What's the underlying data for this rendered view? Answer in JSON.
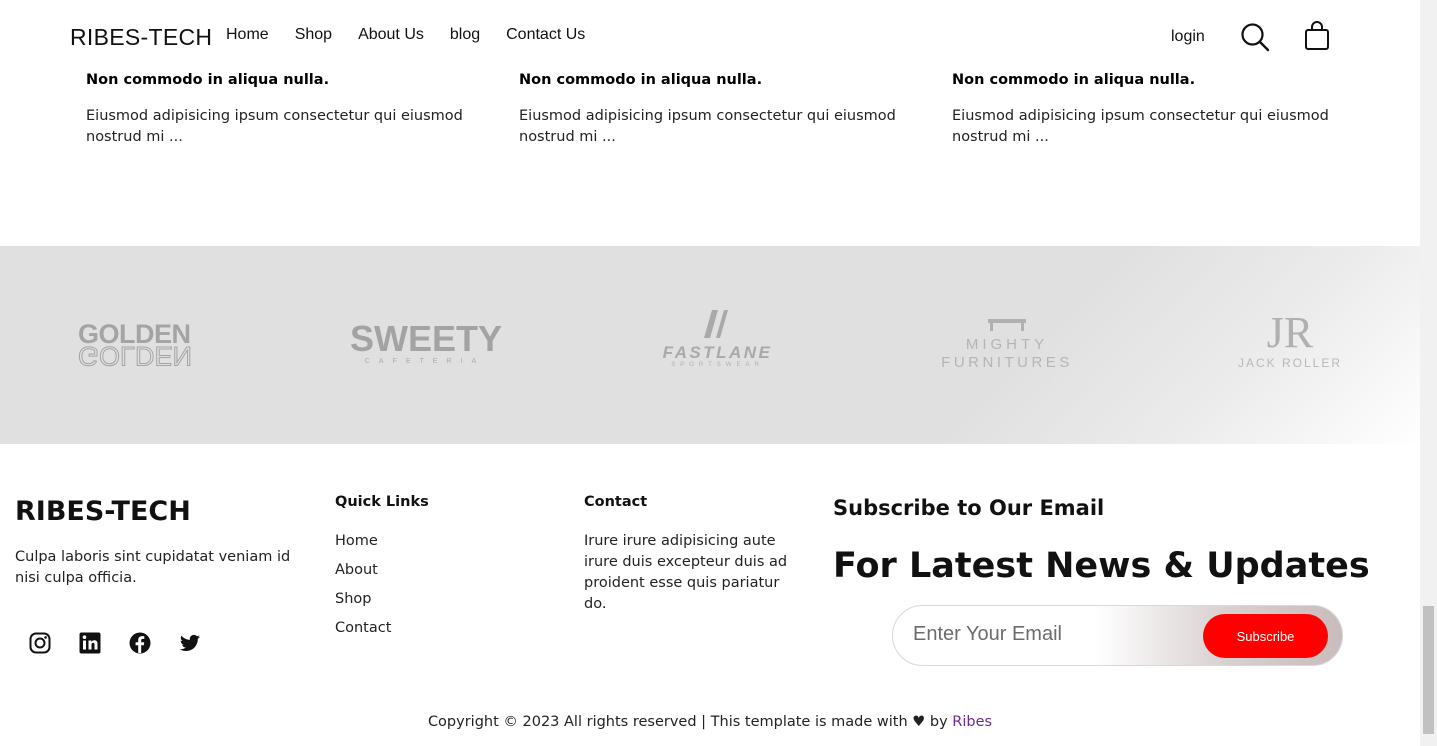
{
  "header": {
    "brand": "RIBES-TECH",
    "nav": [
      "Home",
      "Shop",
      "About Us",
      "blog",
      "Contact Us"
    ],
    "login": "login",
    "icons": [
      "search-icon",
      "shopping-bag-icon"
    ]
  },
  "blog_cards": [
    {
      "title": "Non commodo in aliqua nulla.",
      "excerpt": "Eiusmod adipisicing ipsum consectetur qui eiusmod nostrud mi ..."
    },
    {
      "title": "Non commodo in aliqua nulla.",
      "excerpt": "Eiusmod adipisicing ipsum consectetur qui eiusmod nostrud mi ..."
    },
    {
      "title": "Non commodo in aliqua nulla.",
      "excerpt": "Eiusmod adipisicing ipsum consectetur qui eiusmod nostrud mi ..."
    }
  ],
  "brand_logos": [
    {
      "name": "GOLDEN",
      "sub": ""
    },
    {
      "name": "SWEETY",
      "sub": "CAFETERIA"
    },
    {
      "name": "FASTLANE",
      "sub": "SPORTSWEAR"
    },
    {
      "name": "MIGHTY",
      "sub": "FURNITURES"
    },
    {
      "name": "JR",
      "sub": "JACK ROLLER"
    }
  ],
  "footer": {
    "brand": "RIBES-TECH",
    "description": "Culpa laboris sint cupidatat veniam id nisi culpa officia.",
    "socials": [
      "instagram-icon",
      "linkedin-icon",
      "facebook-icon",
      "twitter-icon"
    ],
    "quick_links_title": "Quick Links",
    "quick_links": [
      "Home",
      "About",
      "Shop",
      "Contact"
    ],
    "contact_title": "Contact",
    "contact_text": "Irure irure adipisicing aute irure duis excepteur duis ad proident esse quis pariatur do.",
    "subscribe_title": "Subscribe to Our Email",
    "subscribe_headline": "For Latest News & Updates",
    "email_placeholder": "Enter Your Email",
    "subscribe_button": "Subscribe",
    "copyright_prefix": "Copyright © 2023 All rights reserved | This template is made with ♥ by",
    "copyright_author": "Ribes"
  },
  "colors": {
    "accent": "#ff0000",
    "brand_band": "#e0e0e0",
    "author_link": "#6b2b8c"
  }
}
